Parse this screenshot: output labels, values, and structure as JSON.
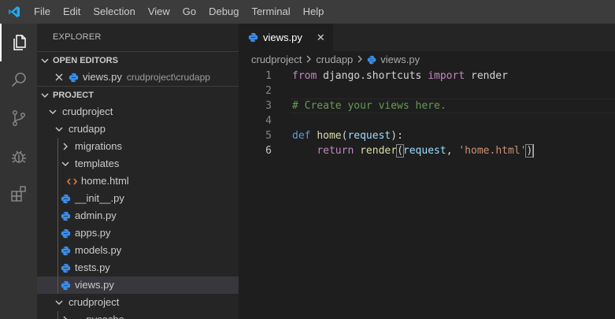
{
  "menu": {
    "items": [
      "File",
      "Edit",
      "Selection",
      "View",
      "Go",
      "Debug",
      "Terminal",
      "Help"
    ]
  },
  "activity_bar": {
    "items": [
      "explorer-icon",
      "search-icon",
      "source-control-icon",
      "debug-icon",
      "extensions-icon"
    ],
    "active": "explorer-icon"
  },
  "sidebar": {
    "title": "EXPLORER",
    "open_editors": {
      "header": "OPEN EDITORS",
      "items": [
        {
          "name": "views.py",
          "description": "crudproject\\crudapp"
        }
      ]
    },
    "project": {
      "header": "PROJECT",
      "tree": [
        {
          "label": "crudproject",
          "type": "folder-open"
        },
        {
          "label": "crudapp",
          "type": "folder-open"
        },
        {
          "label": "migrations",
          "type": "folder-closed"
        },
        {
          "label": "templates",
          "type": "folder-open"
        },
        {
          "label": "home.html",
          "type": "html"
        },
        {
          "label": "__init__.py",
          "type": "python"
        },
        {
          "label": "admin.py",
          "type": "python"
        },
        {
          "label": "apps.py",
          "type": "python"
        },
        {
          "label": "models.py",
          "type": "python"
        },
        {
          "label": "tests.py",
          "type": "python"
        },
        {
          "label": "views.py",
          "type": "python",
          "selected": true
        },
        {
          "label": "crudproject",
          "type": "folder-open"
        },
        {
          "label": "__pycache__",
          "type": "folder-closed"
        }
      ]
    }
  },
  "editor": {
    "tab": {
      "label": "views.py",
      "close": "✕"
    },
    "breadcrumb": [
      "crudproject",
      "crudapp",
      "views.py"
    ],
    "lines": [
      {
        "n": "1",
        "text": "from django.shortcuts import render"
      },
      {
        "n": "2",
        "text": ""
      },
      {
        "n": "3",
        "text": "# Create your views here."
      },
      {
        "n": "4",
        "text": ""
      },
      {
        "n": "5",
        "text": "def home(request):"
      },
      {
        "n": "6",
        "text": "    return render(request, 'home.html')"
      }
    ]
  },
  "colors": {
    "keyword": "#c586c0",
    "def_keyword": "#569cd6",
    "function": "#dcdcaa",
    "parameter": "#9cdcfe",
    "string": "#ce9178",
    "comment": "#6a9955",
    "python_icon": "#3b8eea",
    "html_icon": "#e37933",
    "vscode_blue": "#23a9f2"
  }
}
